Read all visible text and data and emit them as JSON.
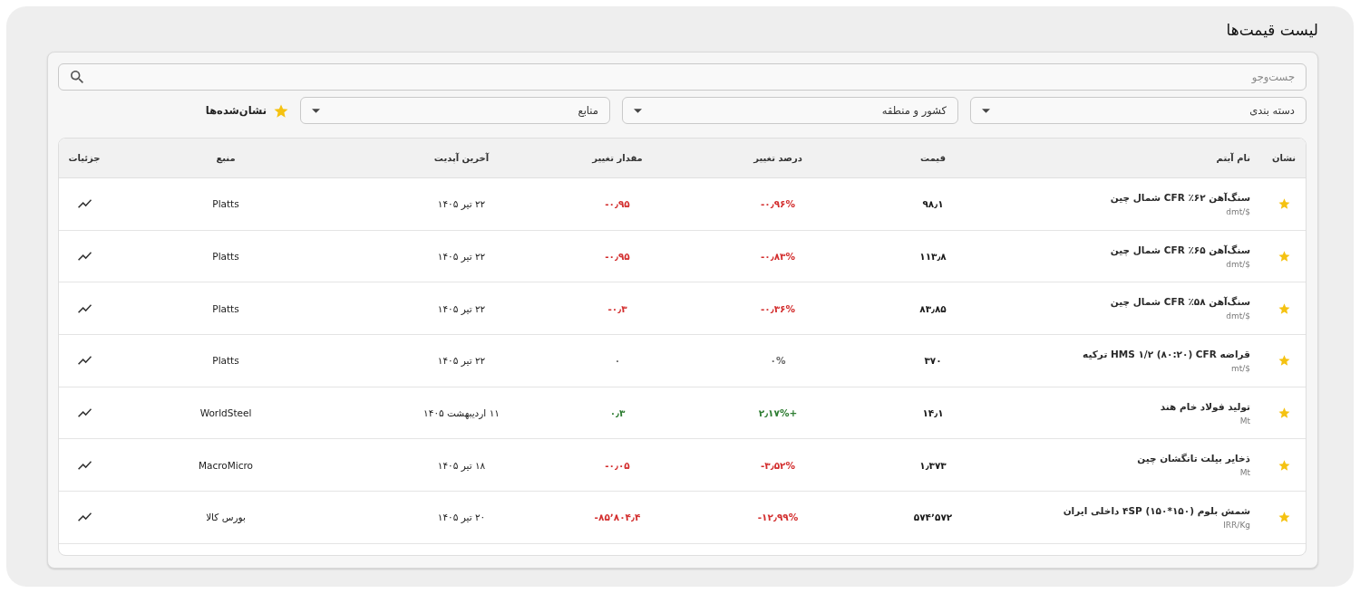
{
  "title": "لیست قیمت‌ها",
  "search": {
    "placeholder": "جست‌وجو"
  },
  "filters": [
    {
      "label": "دسته بندی"
    },
    {
      "label": "کشور و منطقه"
    },
    {
      "label": "منابع"
    }
  ],
  "bookmark_filter": {
    "label": "نشان‌شده‌ها",
    "on": true
  },
  "table": {
    "columns": [
      "نشان",
      "نام آیتم",
      "قیمت",
      "درصد تغییر",
      "مقدار تغییر",
      "آخرین آپدیت",
      "منبع",
      "جزئیات"
    ],
    "rows": [
      {
        "bookmarked": true,
        "name": "سنگ‌آهن ۶۲٪ CFR شمال چین",
        "unit": "dmt/$",
        "price": "۹۸٫۱",
        "change_percent": "-۰٫۹۶%",
        "change_amount": "-۰٫۹۵",
        "color": "#d32f2f",
        "updated": "۲۲ تیر ۱۴۰۵",
        "source": "Platts"
      },
      {
        "bookmarked": true,
        "name": "سنگ‌آهن ۶۵٪ CFR شمال چین",
        "unit": "dmt/$",
        "price": "۱۱۳٫۸",
        "change_percent": "-۰٫۸۳%",
        "change_amount": "-۰٫۹۵",
        "color": "#d32f2f",
        "updated": "۲۲ تیر ۱۴۰۵",
        "source": "Platts"
      },
      {
        "bookmarked": true,
        "name": "سنگ‌آهن ۵۸٪ CFR شمال چین",
        "unit": "dmt/$",
        "price": "۸۳٫۸۵",
        "change_percent": "-۰٫۳۶%",
        "change_amount": "-۰٫۳",
        "color": "#d32f2f",
        "updated": "۲۲ تیر ۱۴۰۵",
        "source": "Platts"
      },
      {
        "bookmarked": true,
        "name": "قراضه HMS ۱/۲ (۸۰:۲۰) CFR ترکیه",
        "unit": "mt/$",
        "price": "۳۷۰",
        "change_percent": "۰%",
        "change_amount": "۰",
        "color": "#666666",
        "updated": "۲۲ تیر ۱۴۰۵",
        "source": "Platts"
      },
      {
        "bookmarked": true,
        "name": "تولید فولاد خام هند",
        "unit": "Mt",
        "price": "۱۴٫۱",
        "change_percent": "۲٫۱۷%+",
        "change_amount": "۰٫۳",
        "color": "#2e7d32",
        "updated": "۱۱ اردیبهشت ۱۴۰۵",
        "source": "WorldSteel"
      },
      {
        "bookmarked": true,
        "name": "ذخایر بیلت تانگشان چین",
        "unit": "Mt",
        "price": "۱٫۳۷۳",
        "change_percent": "-۳٫۵۲%",
        "change_amount": "-۰٫۰۵",
        "color": "#d32f2f",
        "updated": "۱۸ تیر ۱۴۰۵",
        "source": "MacroMicro"
      },
      {
        "bookmarked": true,
        "name": "شمش بلوم (۱۵۰*۱۵۰) ۴SP داخلی ایران",
        "unit": "IRR/Kg",
        "price": "۵۷۴٬۵۷۲",
        "change_percent": "-۱۲٫۹۹%",
        "change_amount": "-۸۵٬۸۰۴٫۴",
        "color": "#d32f2f",
        "updated": "۲۰ تیر ۱۴۰۵",
        "source": "بورس کالا"
      }
    ]
  }
}
